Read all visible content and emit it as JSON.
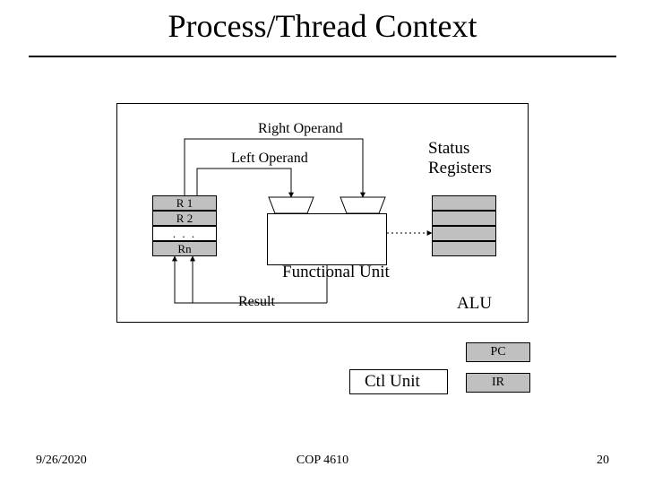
{
  "title": "Process/Thread Context",
  "footer": {
    "date": "9/26/2020",
    "course": "COP 4610",
    "page": "20"
  },
  "labels": {
    "right_operand": "Right Operand",
    "left_operand": "Left Operand",
    "status_registers": "Status\nRegisters",
    "functional_unit": "Functional Unit",
    "result": "Result",
    "alu": "ALU",
    "ctl_unit": "Ctl Unit",
    "pc": "PC",
    "ir": "IR"
  },
  "registers": {
    "r1": "R 1",
    "r2": "R 2",
    "dots": ". . .",
    "rn": "Rn"
  }
}
